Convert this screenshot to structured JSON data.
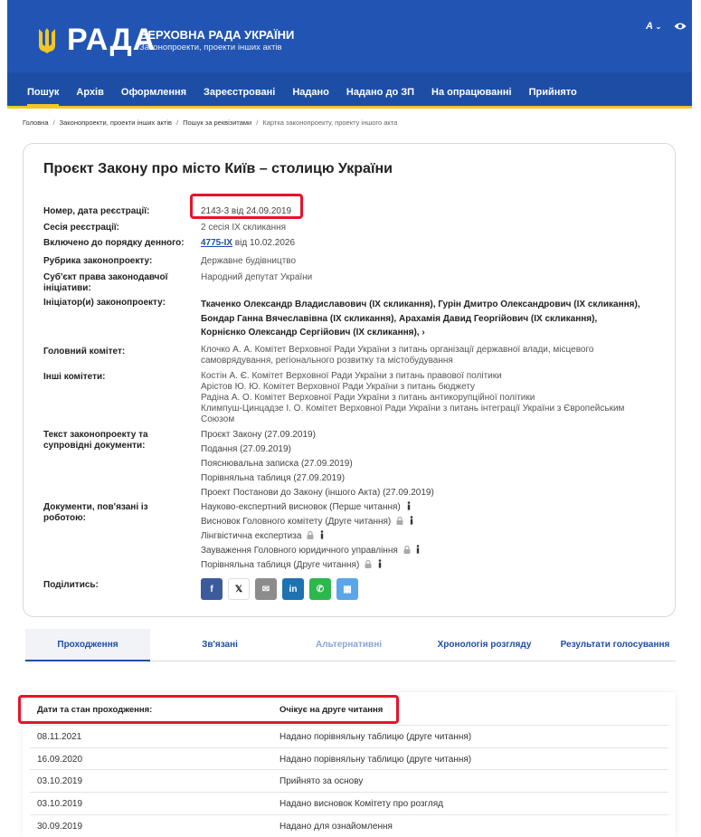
{
  "header": {
    "logo": "РАДА",
    "title": "ВЕРХОВНА РАДА УКРАЇНИ",
    "subtitle": "Законопроекти, проекти інших актів",
    "font_control": "A"
  },
  "nav": {
    "items": [
      "Пошук",
      "Архів",
      "Оформлення",
      "Зареєстровані",
      "Надано",
      "Надано до ЗП",
      "На опрацюванні",
      "Прийнято"
    ]
  },
  "breadcrumb": [
    "Головна",
    "Законопроекти, проекти інших актів",
    "Пошук за реквізитами",
    "Картка законопроекту, проекту іншого акта"
  ],
  "bill": {
    "title": "Проєкт Закону про місто Київ – столицю України",
    "labels": {
      "number": "Номер, дата реєстрації:",
      "session": "Сесія реєстрації:",
      "agenda": "Включено до порядку денного:",
      "rubric": "Рубрика законопроекту:",
      "subject": "Суб'єкт права законодавчої ініціативи:",
      "initiators": "Ініціатор(и) законопроекту:",
      "main_committee": "Головний комітет:",
      "other_committees": "Інші комітети:",
      "texts": "Текст законопроекту та супровідні документи:",
      "work_docs": "Документи, пов'язані із роботою:",
      "share": "Поділитись:"
    },
    "number": "2143-3 від 24.09.2019",
    "session": "2 сесія IX скликання",
    "agenda_link": "4775-IX",
    "agenda_date": " від 10.02.2026",
    "rubric": "Державне будівництво",
    "subject": "Народний депутат України",
    "initiators": "Ткаченко Олександр Владиславович (IX скликання), Гурін Дмитро Олександрович (IX скликання), Бондар Ганна Вячеславівна (IX скликання), Арахамія Давид Георгійович (IX скликання), Корнієнко Олександр Сергійович (IX скликання),",
    "main_committee": "Клочко А. А. Комітет Верховної Ради України з питань організації державної влади, місцевого самоврядування, регіонального розвитку та містобудування",
    "other_committees": [
      "Костін А. Є. Комітет Верховної Ради України з питань правової політики",
      "Арістов Ю. Ю. Комітет Верховної Ради України з питань бюджету",
      "Радіна А. О. Комітет Верховної Ради України з питань антикорупційної політики",
      "Климпуш-Цинцадзе І. О. Комітет Верховної Ради України з питань інтеграції України з Європейським Союзом"
    ],
    "texts": [
      "Проєкт Закону (27.09.2019)",
      "Подання (27.09.2019)",
      "Пояснювальна записка (27.09.2019)",
      "Порівняльна таблиця (27.09.2019)",
      "Проект Постанови до Закону (іншого Акта) (27.09.2019)"
    ],
    "work_docs": [
      "Науково-експертний висновок (Перше читання)",
      "Висновок Головного комітету (Друге читання)",
      "Лінгвістична експертиза",
      "Зауваження Головного юридичного управління",
      "Порівняльна таблиця (Друге читання)"
    ]
  },
  "share": {
    "facebook": "f",
    "x": "𝕏",
    "email": "✉",
    "linkedin": "in",
    "whatsapp": "✆",
    "qr": "▦"
  },
  "tabs": [
    "Проходження",
    "Зв'язані",
    "Альтернативні",
    "Хронологія розгляду",
    "Результати голосування"
  ],
  "passage": {
    "header_dates": "Дати та стан проходження:",
    "header_status": "Очікує на друге читання",
    "rows": [
      {
        "date": "08.11.2021",
        "status": "Надано порівняльну таблицю (друге читання)"
      },
      {
        "date": "16.09.2020",
        "status": "Надано порівняльну таблицю (друге читання)"
      },
      {
        "date": "03.10.2019",
        "status": "Прийнято за основу"
      },
      {
        "date": "03.10.2019",
        "status": "Надано висновок Комітету про розгляд"
      },
      {
        "date": "30.09.2019",
        "status": "Надано для ознайомлення"
      }
    ]
  },
  "colors": {
    "header_bg": "#2255b3",
    "nav_bg": "#1d4ea6",
    "accent_yellow": "#f3c623",
    "link_blue": "#1d4ea6",
    "highlight_red": "#e8122b"
  }
}
